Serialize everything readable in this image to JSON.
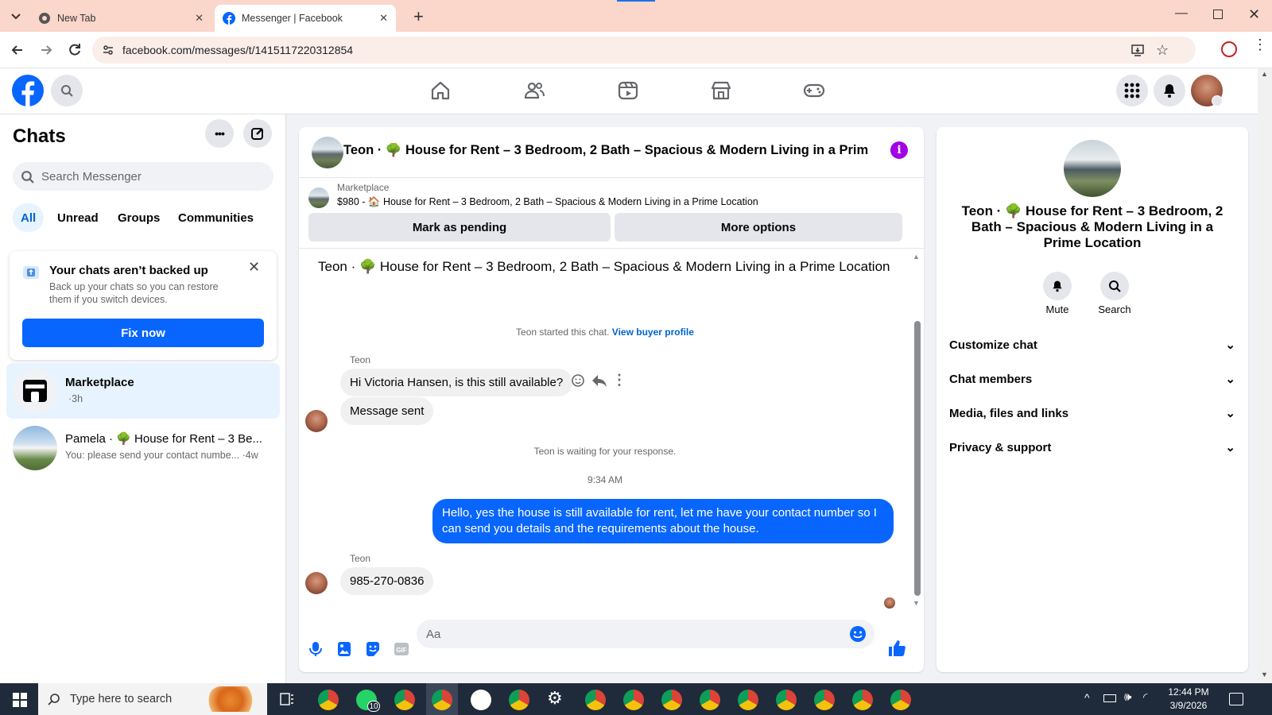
{
  "browser": {
    "tabs": [
      {
        "title": "New Tab"
      },
      {
        "title": "Messenger | Facebook"
      }
    ],
    "url": "facebook.com/messages/t/1415117220312854"
  },
  "left": {
    "title": "Chats",
    "search_placeholder": "Search Messenger",
    "filters": [
      "All",
      "Unread",
      "Groups",
      "Communities"
    ],
    "backup": {
      "title": "Your chats aren’t backed up",
      "body": "Back up your chats so you can restore them if you switch devices.",
      "button": "Fix now"
    },
    "chats": [
      {
        "name": "Marketplace",
        "snippet": "·3h"
      },
      {
        "name": "Pamela · 🌳 House for Rent – 3 Be...",
        "snippet": "You: please send your contact numbe... ·4w"
      }
    ]
  },
  "conversation": {
    "header_title": "Teon · 🌳 House for Rent – 3 Bedroom, 2 Bath – Spacious & Modern Living in a Prim…",
    "marketplace_label": "Marketplace",
    "listing_line": "$980 - 🏠 House for Rent – 3 Bedroom, 2 Bath – Spacious & Modern Living in a Prime Location",
    "btn_pending": "Mark as pending",
    "btn_more": "More options",
    "intro_title": "Teon · 🌳 House for Rent – 3 Bedroom, 2 Bath – Spacious & Modern Living in a Prime Location",
    "started_text": "Teon started this chat.",
    "buyer_link": "View buyer profile",
    "sender1": "Teon",
    "msg1": "Hi Victoria Hansen, is this still available?",
    "msg2": "Message sent",
    "waiting": "Teon is waiting for your response.",
    "time": "9:34 AM",
    "my_msg": "Hello, yes the house is still available for rent, let me have your contact number so I can send you details and the requirements about the house.",
    "sender2": "Teon",
    "msg3": "985-270-0836",
    "input_placeholder": "Aa"
  },
  "right": {
    "title": "Teon · 🌳 House for Rent – 3 Bedroom, 2 Bath – Spacious & Modern Living in a Prime Location",
    "mute": "Mute",
    "search": "Search",
    "sections": [
      "Customize chat",
      "Chat members",
      "Media, files and links",
      "Privacy & support"
    ]
  },
  "taskbar": {
    "search_text": "Type here to search",
    "whatsapp_badge": "10",
    "time": "12:44 PM",
    "date": "3/9/2026"
  },
  "colors": {
    "brand": "#0866ff",
    "tabbar": "#fbd6cb",
    "taskbar": "#1f2a3a"
  }
}
